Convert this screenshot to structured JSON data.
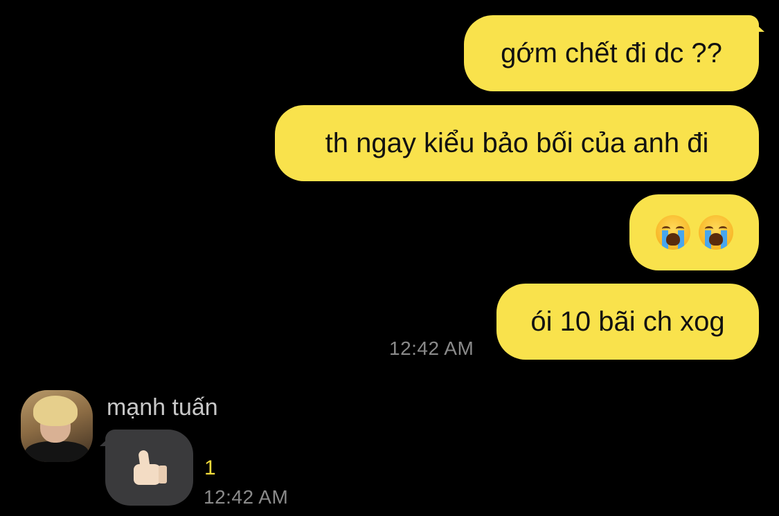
{
  "outgoing_messages": [
    {
      "text": "gớm chết đi dc ??"
    },
    {
      "text": "th ngay kiểu bảo bối của anh đi"
    },
    {
      "emoji": [
        "loudly-crying-face",
        "loudly-crying-face"
      ]
    },
    {
      "text": "ói 10 bãi ch xog"
    }
  ],
  "outgoing_timestamp": "12:42 AM",
  "incoming": {
    "sender_name": "mạnh tuấn",
    "message_emoji": "thumbs-up",
    "unread_count": "1",
    "timestamp": "12:42 AM"
  },
  "colors": {
    "outgoing_bubble": "#f9e24c",
    "incoming_bubble": "#3a3a3c",
    "background": "#000000",
    "unread": "#f4dc3c",
    "timestamp": "#8a8a8a"
  }
}
